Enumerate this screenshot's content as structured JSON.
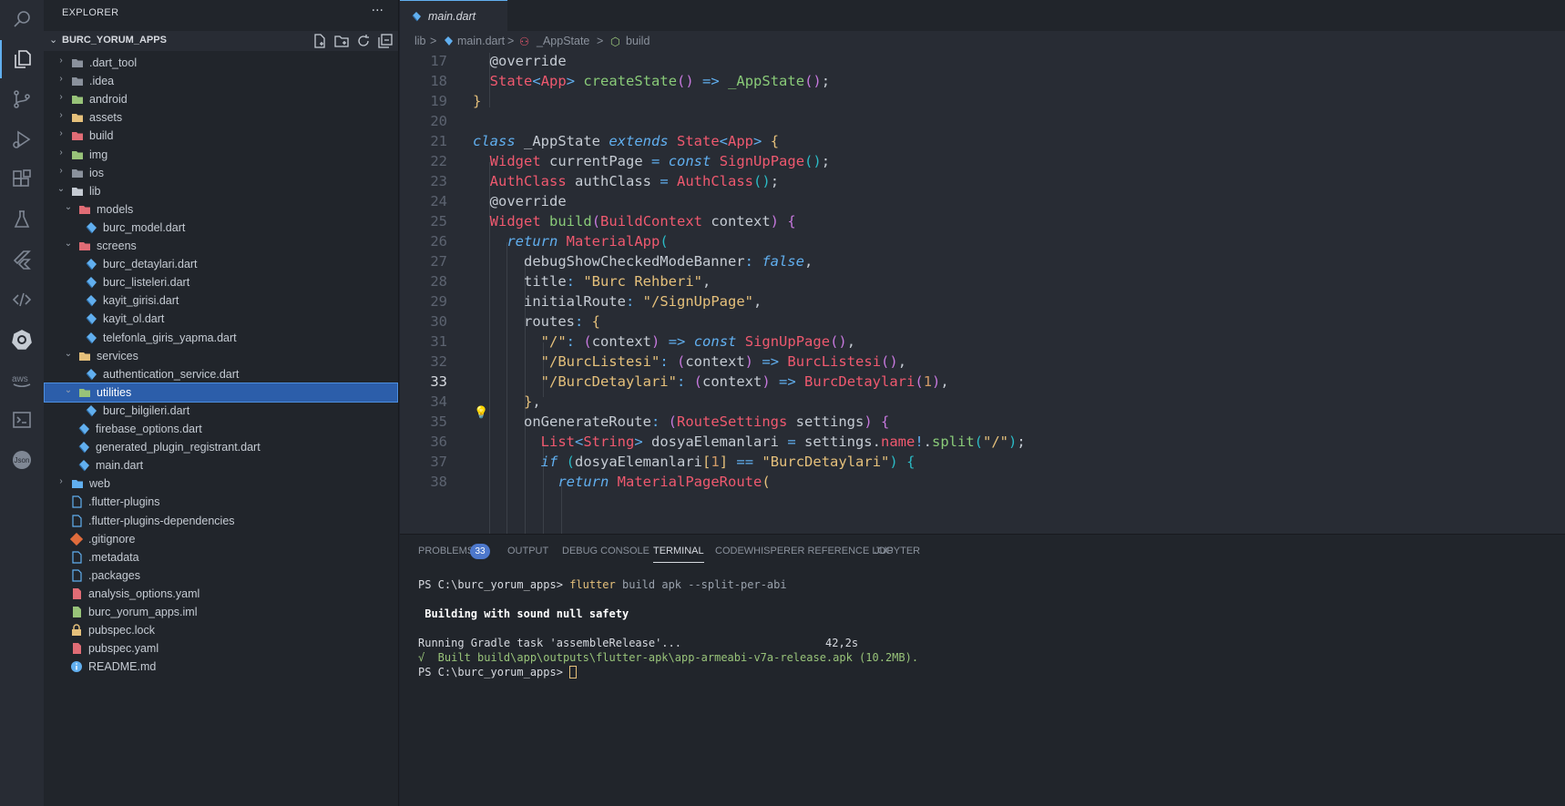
{
  "explorer": {
    "title": "EXPLORER",
    "menu": "···",
    "project": "BURC_YORUM_APPS",
    "items": [
      {
        "label": ".dart_tool",
        "type": "folder",
        "color": "#8a919c"
      },
      {
        "label": ".idea",
        "type": "folder",
        "color": "#8a919c"
      },
      {
        "label": "android",
        "type": "folder",
        "color": "#98c379"
      },
      {
        "label": "assets",
        "type": "folder",
        "color": "#e5c07b"
      },
      {
        "label": "build",
        "type": "folder",
        "color": "#e06c75"
      },
      {
        "label": "img",
        "type": "folder",
        "color": "#98c379"
      },
      {
        "label": "ios",
        "type": "folder",
        "color": "#8a919c"
      },
      {
        "label": "lib",
        "type": "folder-open",
        "color": "#c5cbd3"
      },
      {
        "label": "models",
        "type": "folder-open",
        "color": "#e06c75"
      },
      {
        "label": "burc_model.dart",
        "type": "dart",
        "color": "#61afef"
      },
      {
        "label": "screens",
        "type": "folder-open",
        "color": "#e06c75"
      },
      {
        "label": "burc_detaylari.dart",
        "type": "dart",
        "color": "#61afef"
      },
      {
        "label": "burc_listeleri.dart",
        "type": "dart",
        "color": "#61afef"
      },
      {
        "label": "kayit_girisi.dart",
        "type": "dart",
        "color": "#61afef"
      },
      {
        "label": "kayit_ol.dart",
        "type": "dart",
        "color": "#61afef"
      },
      {
        "label": "telefonla_giris_yapma.dart",
        "type": "dart",
        "color": "#61afef"
      },
      {
        "label": "services",
        "type": "folder-open",
        "color": "#e5c07b"
      },
      {
        "label": "authentication_service.dart",
        "type": "dart",
        "color": "#61afef"
      },
      {
        "label": "utilities",
        "type": "folder-open",
        "color": "#98c379"
      },
      {
        "label": "burc_bilgileri.dart",
        "type": "dart",
        "color": "#61afef"
      },
      {
        "label": "firebase_options.dart",
        "type": "dart",
        "color": "#61afef"
      },
      {
        "label": "generated_plugin_registrant.dart",
        "type": "dart",
        "color": "#61afef"
      },
      {
        "label": "main.dart",
        "type": "dart",
        "color": "#61afef"
      },
      {
        "label": "web",
        "type": "folder",
        "color": "#61afef"
      },
      {
        "label": ".flutter-plugins",
        "type": "file",
        "color": "#61afef"
      },
      {
        "label": ".flutter-plugins-dependencies",
        "type": "file",
        "color": "#61afef"
      },
      {
        "label": ".gitignore",
        "type": "git",
        "color": "#e06c3c"
      },
      {
        "label": ".metadata",
        "type": "file",
        "color": "#61afef"
      },
      {
        "label": ".packages",
        "type": "file",
        "color": "#61afef"
      },
      {
        "label": "analysis_options.yaml",
        "type": "yaml",
        "color": "#e06c75"
      },
      {
        "label": "burc_yorum_apps.iml",
        "type": "iml",
        "color": "#98c379"
      },
      {
        "label": "pubspec.lock",
        "type": "lock",
        "color": "#e5c07b"
      },
      {
        "label": "pubspec.yaml",
        "type": "yaml",
        "color": "#e06c75"
      },
      {
        "label": "README.md",
        "type": "info",
        "color": "#61afef"
      }
    ]
  },
  "tab": {
    "label": "main.dart"
  },
  "breadcrumb": {
    "lib": "lib",
    "sep": ">",
    "file": "main.dart",
    "cls": "_AppState",
    "method": "build"
  },
  "editor": {
    "line_numbers": [
      "17",
      "18",
      "19",
      "20",
      "21",
      "22",
      "23",
      "24",
      "25",
      "26",
      "27",
      "28",
      "29",
      "30",
      "31",
      "32",
      "33",
      "34",
      "35",
      "36",
      "37",
      "38"
    ],
    "current_line": "33"
  },
  "panel": {
    "tabs": [
      "PROBLEMS",
      "OUTPUT",
      "DEBUG CONSOLE",
      "TERMINAL",
      "CODEWHISPERER REFERENCE LOG",
      "JUPYTER"
    ],
    "problems_count": "33",
    "terminal": {
      "prompt1": "PS C:\\burc_yorum_apps>",
      "cmd1_a": "flutter",
      "cmd1_b": " build apk --split-per-abi",
      "building": " Building with sound null safety",
      "gradle": "Running Gradle task 'assembleRelease'...",
      "gradle_time": "42,2s",
      "built": "√  Built build\\app\\outputs\\flutter-apk\\app-armeabi-v7a-release.apk (10.2MB).",
      "prompt2": "PS C:\\burc_yorum_apps>"
    }
  },
  "colors": {
    "accent": "#61afef",
    "selection": "#2c5eaa",
    "badge": "#4d78cc"
  }
}
